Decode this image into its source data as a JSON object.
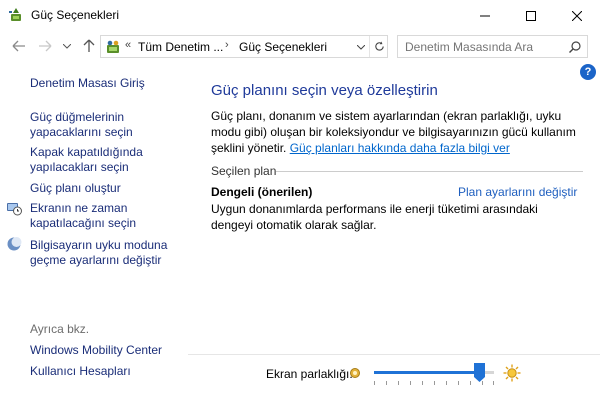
{
  "window": {
    "title": "Güç Seçenekleri",
    "icon": "power-options-icon"
  },
  "nav": {
    "breadcrumb_prefix": "«",
    "crumbs": [
      "Tüm Denetim ...",
      "Güç Seçenekleri"
    ],
    "separator": "›",
    "search_placeholder": "Denetim Masasında Ara"
  },
  "sidebar": {
    "home": "Denetim Masası Giriş",
    "links": [
      {
        "line1": "Güç düğmelerinin",
        "line2": "yapacaklarını seçin"
      },
      {
        "line1": "Kapak kapatıldığında",
        "line2": "yapılacakları seçin"
      },
      {
        "line1": "Güç planı oluştur",
        "line2": ""
      },
      {
        "line1": "Ekranın ne zaman",
        "line2": "kapatılacağını seçin",
        "icon": "clock-monitor-icon"
      },
      {
        "line1": "Bilgisayarın uyku moduna",
        "line2": "geçme ayarlarını değiştir",
        "icon": "moon-icon"
      }
    ],
    "see_also_heading": "Ayrıca bkz.",
    "see_also": [
      "Windows Mobility Center",
      "Kullanıcı Hesapları"
    ]
  },
  "main": {
    "title": "Güç planını seçin veya özelleştirin",
    "description": "Güç planı, donanım ve sistem ayarlarından (ekran parlaklığı, uyku modu gibi) oluşan bir koleksiyondur ve bilgisayarınızın gücü kullanım şeklini yönetir.",
    "learn_more": "Güç planları hakkında daha fazla bilgi ver",
    "group_label": "Seçilen plan",
    "plan": {
      "name": "Dengeli (önerilen)",
      "change_link": "Plan ayarlarını değiştir",
      "description": "Uygun donanımlarda performans ile enerji tüketimi arasındaki dengeyi otomatik olarak sağlar."
    }
  },
  "brightness": {
    "label": "Ekran parlaklığı:",
    "level_fraction": 0.88
  },
  "colors": {
    "link": "#1a2d78",
    "title": "#1f3a9a",
    "accent": "#1f72d6"
  }
}
